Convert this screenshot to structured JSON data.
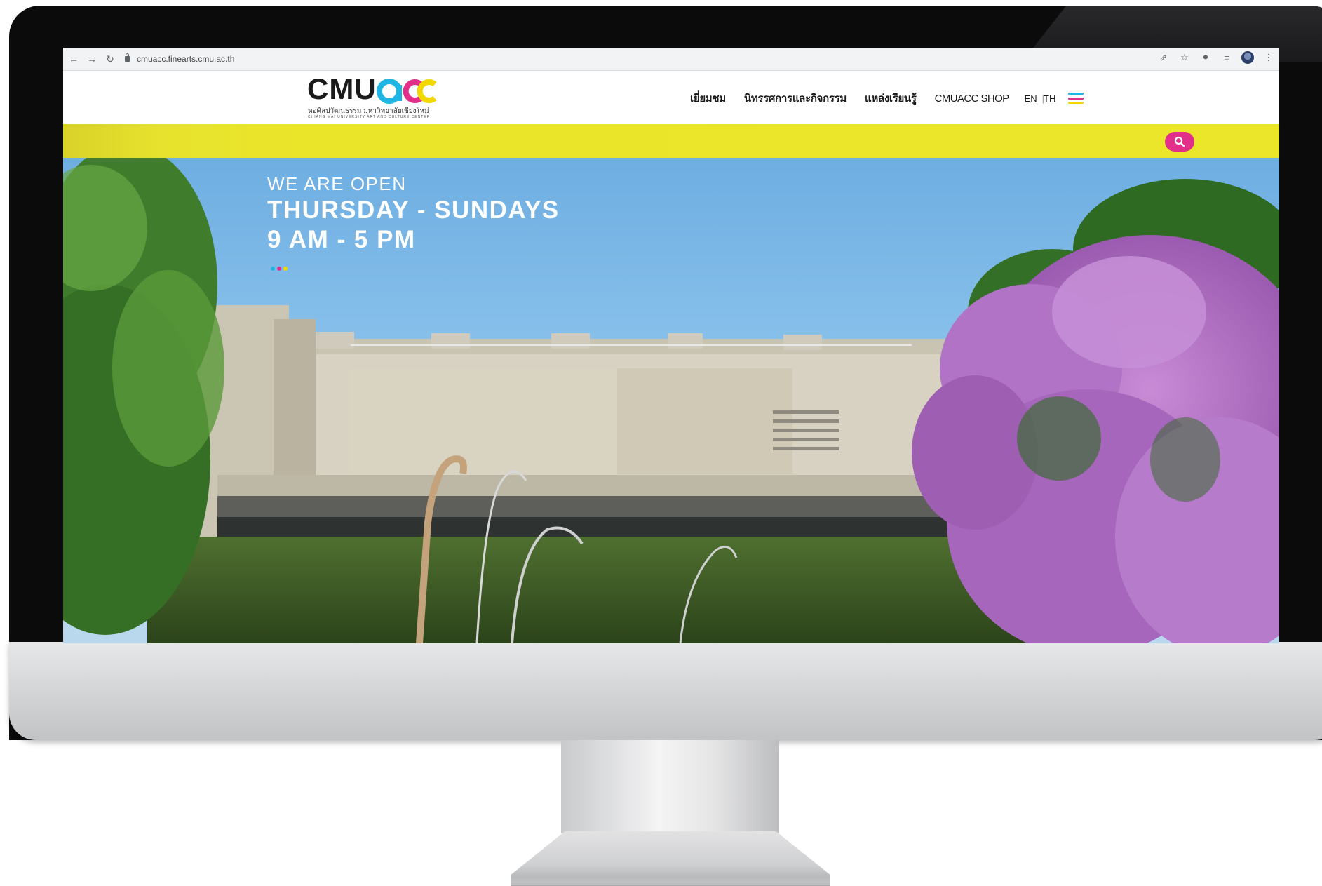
{
  "browser": {
    "url": "cmuacc.finearts.cmu.ac.th",
    "icons": [
      "back-arrow-icon",
      "forward-arrow-icon",
      "reload-icon",
      "lock-icon",
      "share-icon",
      "star-icon",
      "extensions-icon",
      "reading-list-icon",
      "profile-icon",
      "more-icon"
    ]
  },
  "header": {
    "logo": {
      "word": "CMU",
      "accent_letters": "acc",
      "subtitle_th": "หอศิลปวัฒนธรรม มหาวิทยาลัยเชียงใหม่",
      "subtitle_en": "CHIANG MAI UNIVERSITY ART AND CULTURE CENTER"
    },
    "menu": [
      {
        "label": "เยี่ยมชม"
      },
      {
        "label": "นิทรรศการและกิจกรรม"
      },
      {
        "label": "แหล่งเรียนรู้"
      },
      {
        "label": "CMUACC SHOP"
      }
    ],
    "lang_en": "EN",
    "lang_separator": "|",
    "lang_th": "TH"
  },
  "hero": {
    "line1": "WE ARE OPEN",
    "line2": "THURSDAY - SUNDAYS",
    "line3": "9 AM - 5 PM",
    "slide_dots": 3
  },
  "colors": {
    "yellow_bar": "#ece62b",
    "search_pink": "#e22f8a",
    "brand_cyan": "#1fb6e6",
    "brand_magenta": "#e22f8a",
    "brand_yellow": "#f2d800"
  }
}
